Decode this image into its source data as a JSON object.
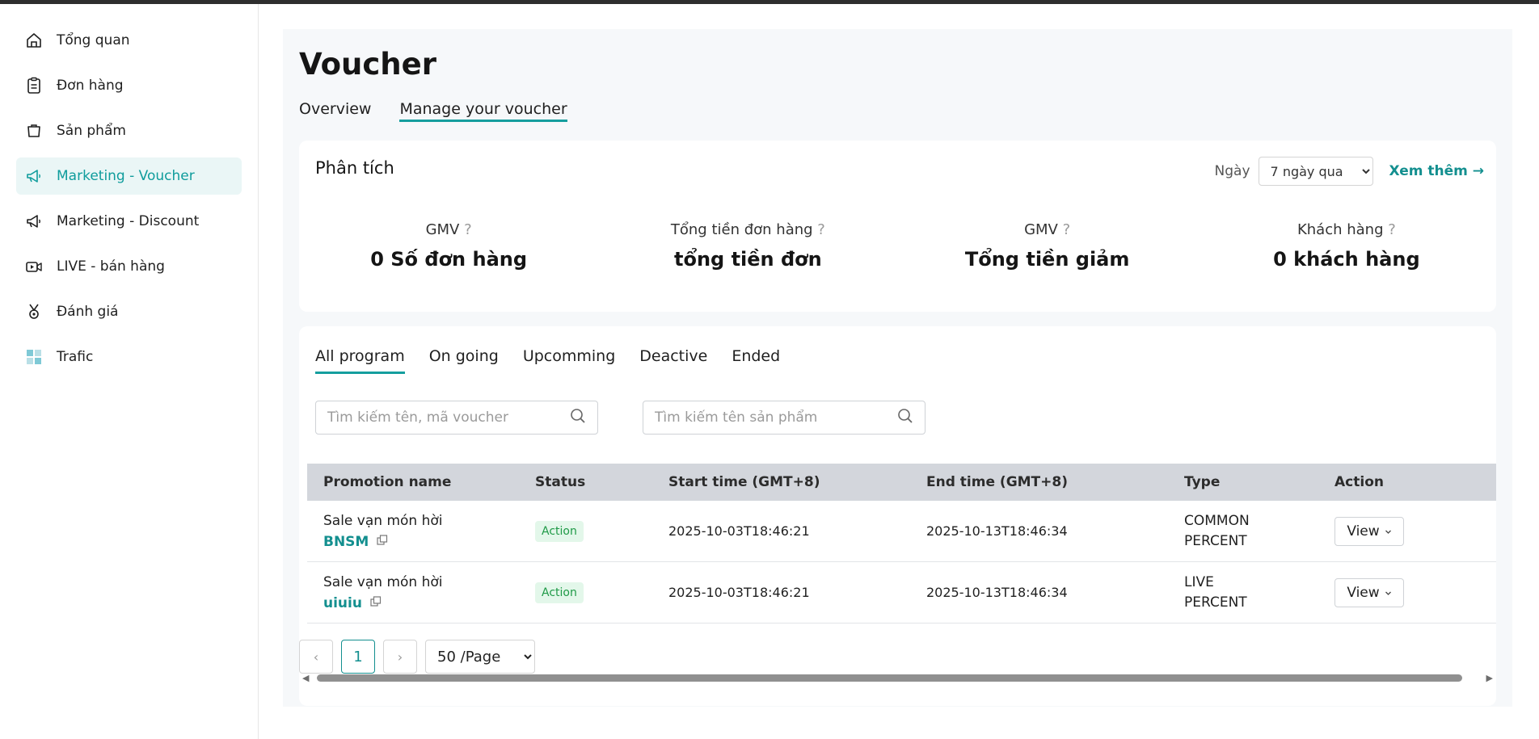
{
  "sidebar": {
    "items": [
      {
        "label": "Tổng quan",
        "icon": "home-icon"
      },
      {
        "label": "Đơn hàng",
        "icon": "clipboard-icon"
      },
      {
        "label": "Sản phẩm",
        "icon": "box-icon"
      },
      {
        "label": "Marketing - Voucher",
        "icon": "megaphone-icon",
        "active": true
      },
      {
        "label": "Marketing - Discount",
        "icon": "megaphone-icon"
      },
      {
        "label": "LIVE - bán hàng",
        "icon": "live-icon"
      },
      {
        "label": "Đánh giá",
        "icon": "medal-icon"
      },
      {
        "label": "Trafic",
        "icon": "grid-icon"
      }
    ]
  },
  "page": {
    "title": "Voucher",
    "tabs": [
      {
        "label": "Overview"
      },
      {
        "label": "Manage your voucher",
        "active": true
      }
    ]
  },
  "analytics": {
    "title": "Phân tích",
    "range_label": "Ngày",
    "range_value": "7 ngày qua",
    "more_label": "Xem thêm →",
    "question_mark": "?",
    "stats": [
      {
        "label": "GMV",
        "value": "0 Số đơn hàng"
      },
      {
        "label": "Tổng tiền đơn hàng",
        "value": "tổng tiền đơn"
      },
      {
        "label": "GMV",
        "value": "Tổng tiền giảm"
      },
      {
        "label": "Khách hàng",
        "value": "0 khách hàng"
      }
    ]
  },
  "programs": {
    "tabs": [
      {
        "label": "All program",
        "active": true
      },
      {
        "label": "On going"
      },
      {
        "label": "Upcomming"
      },
      {
        "label": "Deactive"
      },
      {
        "label": "Ended"
      }
    ],
    "search_voucher_placeholder": "Tìm kiếm tên, mã voucher",
    "search_product_placeholder": "Tìm kiếm tên sản phẩm",
    "columns": [
      "Promotion name",
      "Status",
      "Start time (GMT+8)",
      "End time (GMT+8)",
      "Type",
      "Action"
    ],
    "rows": [
      {
        "name": "Sale vạn món hời",
        "code": "BNSM",
        "status": "Action",
        "start": "2025-10-03T18:46:21",
        "end": "2025-10-13T18:46:34",
        "type_line1": "COMMON",
        "type_line2": "PERCENT",
        "action": "View"
      },
      {
        "name": "Sale vạn món hời",
        "code": "uiuiu",
        "status": "Action",
        "start": "2025-10-03T18:46:21",
        "end": "2025-10-13T18:46:34",
        "type_line1": "LIVE",
        "type_line2": "PERCENT",
        "action": "View"
      }
    ],
    "pagination": {
      "prev": "‹",
      "current_page": "1",
      "next": "›",
      "page_size": "50 /Page"
    }
  },
  "colors": {
    "accent": "#159e9e",
    "active_bg": "#eaf6f6",
    "badge_bg": "#e3f7ea",
    "badge_text": "#1f9a47",
    "header_bg": "#d3d6dc"
  }
}
